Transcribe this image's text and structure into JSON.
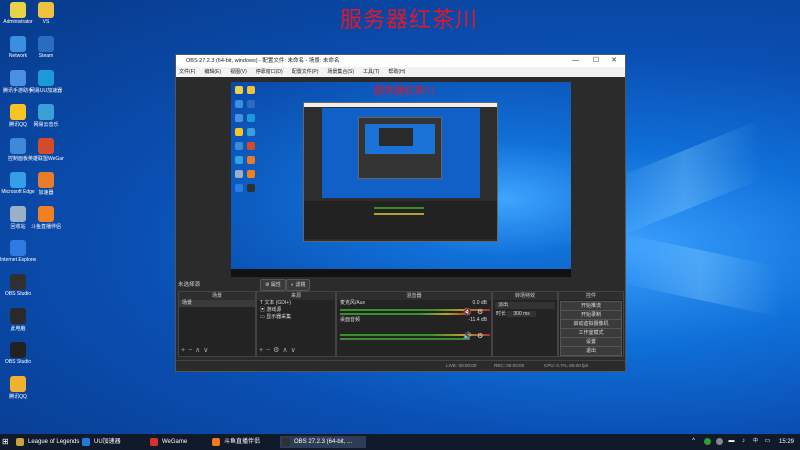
{
  "desktop": {
    "title": "服务器红茶川",
    "icons": [
      {
        "label": "Administrator"
      },
      {
        "label": "VS"
      },
      {
        "label": "Network"
      },
      {
        "label": "Steam"
      },
      {
        "label": "腾讯手游助手"
      },
      {
        "label": "网易UU加速器"
      },
      {
        "label": "腾讯QQ"
      },
      {
        "label": "网易云音乐"
      },
      {
        "label": "控制面板"
      },
      {
        "label": "英雄联盟WeGame"
      },
      {
        "label": "Microsoft Edge"
      },
      {
        "label": "加速器"
      },
      {
        "label": "回收站"
      },
      {
        "label": "斗鱼直播伴侣"
      },
      {
        "label": "Internet Explorer"
      },
      {
        "label": "OBS Studio"
      },
      {
        "label": "此电脑"
      },
      {
        "label": "OBS Studio"
      },
      {
        "label": "腾讯QQ"
      }
    ]
  },
  "obs": {
    "window_title": "OBS 27.2.3 (64-bit, windows) - 配置文件: 未命名 - 场景: 未命名",
    "menu": [
      "文件(F)",
      "编辑(E)",
      "视图(V)",
      "停靠窗口(D)",
      "配置文件(P)",
      "场景集合(S)",
      "工具(T)",
      "帮助(H)"
    ],
    "preview_overlay_title": "服务器红茶川",
    "scene_label": "未选择源",
    "props_button": "属性",
    "filters_button": "滤镜",
    "docks": {
      "scenes": {
        "header": "场景",
        "items": [
          "场景"
        ]
      },
      "sources": {
        "header": "来源",
        "items": [
          "文本 (GDI+)",
          "游戏源",
          "显示器采集"
        ]
      },
      "mixer": {
        "header": "混音器",
        "ch1": "麦克风/Aux",
        "ch1_db": "0.0 dB",
        "ch2": "桌面音频",
        "ch2_db": "-11.4 dB"
      },
      "transitions": {
        "header": "转场特效",
        "type": "淡出",
        "duration_label": "时长",
        "duration": "300 ms"
      },
      "controls": {
        "header": "控件",
        "buttons": [
          "开始推流",
          "开始录制",
          "启动虚拟摄像机",
          "工作室模式",
          "设置",
          "退出"
        ]
      }
    },
    "status": {
      "live": "LIVE: 00:00:00",
      "rec": "REC: 00:00:00",
      "cpu": "CPU: 0.7%, 60.00 fps"
    }
  },
  "taskbar": {
    "items": [
      "League of Legends",
      "UU加速器",
      "WeGame",
      "斗鱼直播伴侣",
      "OBS 27.2.3 (64-bit, ..."
    ],
    "clock": "15:29"
  }
}
